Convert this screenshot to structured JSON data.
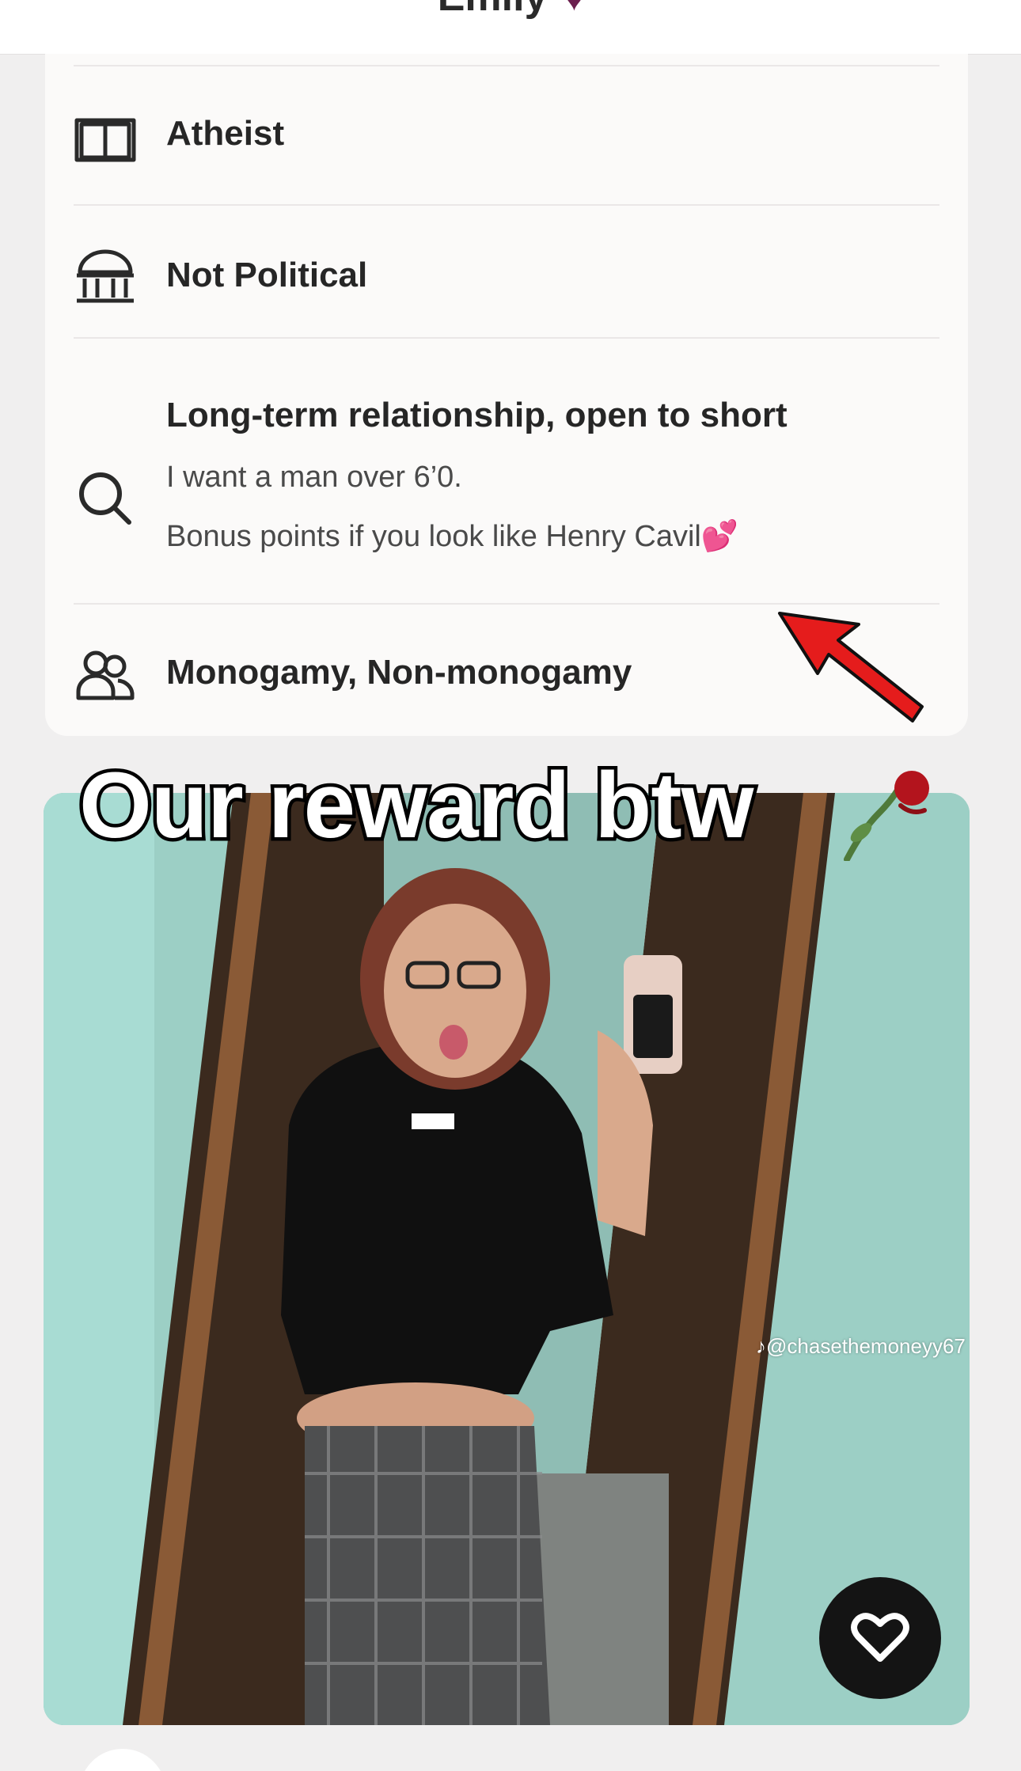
{
  "header": {
    "name": "Emily",
    "heart_icon": "heart-icon",
    "more_icon": "more-icon"
  },
  "profile_card": {
    "religion": {
      "icon": "book-icon",
      "label": "Atheist"
    },
    "politics": {
      "icon": "government-building-icon",
      "label": "Not Political"
    },
    "looking_for": {
      "icon": "search-icon",
      "label": "Long-term relationship, open to short",
      "prompt_line1": "I want a man over 6’0.",
      "prompt_line2": "Bonus points if you look like Henry Cavil",
      "prompt_emoji": "💕"
    },
    "relationship_type": {
      "icon": "people-icon",
      "label": "Monogamy, Non-monogamy"
    }
  },
  "overlay": {
    "caption": "Our reward btw",
    "caption_emoji": "🥀",
    "watermark": "@chasethemoneyy67"
  },
  "photo_card": {
    "like_button_icon": "heart-outline-icon"
  },
  "colors": {
    "background": "#f0efef",
    "card": "#fbfaf9",
    "accent_heart": "#6b1f4e",
    "annotation_arrow": "#e51c1c",
    "like_button": "#141414"
  }
}
